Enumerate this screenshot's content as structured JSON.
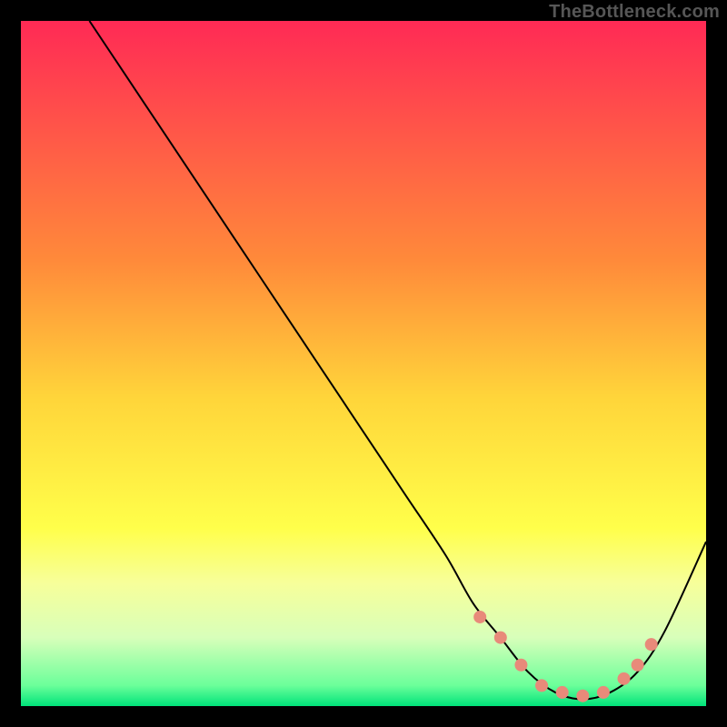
{
  "attribution": "TheBottleneck.com",
  "chart_data": {
    "type": "line",
    "title": "",
    "xlabel": "",
    "ylabel": "",
    "xlim": [
      0,
      100
    ],
    "ylim": [
      0,
      100
    ],
    "background": {
      "type": "vertical-gradient",
      "stops": [
        {
          "offset": 0,
          "color": "#ff2a55"
        },
        {
          "offset": 35,
          "color": "#ff8a3a"
        },
        {
          "offset": 55,
          "color": "#ffd53a"
        },
        {
          "offset": 74,
          "color": "#ffff4a"
        },
        {
          "offset": 82,
          "color": "#f7ff9a"
        },
        {
          "offset": 90,
          "color": "#d8ffba"
        },
        {
          "offset": 97,
          "color": "#6bff9a"
        },
        {
          "offset": 100,
          "color": "#00e37a"
        }
      ]
    },
    "series": [
      {
        "name": "bottleneck-curve",
        "color": "#000000",
        "x": [
          10,
          14,
          20,
          26,
          32,
          38,
          44,
          50,
          56,
          62,
          66,
          70,
          74,
          78,
          82,
          86,
          90,
          94,
          100
        ],
        "y": [
          100,
          94,
          85,
          76,
          67,
          58,
          49,
          40,
          31,
          22,
          15,
          10,
          5,
          2,
          1,
          2,
          5,
          11,
          24
        ]
      }
    ],
    "markers": {
      "name": "highlight-dots",
      "color": "#e88a7a",
      "points": [
        {
          "x": 67,
          "y": 13
        },
        {
          "x": 70,
          "y": 10
        },
        {
          "x": 73,
          "y": 6
        },
        {
          "x": 76,
          "y": 3
        },
        {
          "x": 79,
          "y": 2
        },
        {
          "x": 82,
          "y": 1.5
        },
        {
          "x": 85,
          "y": 2
        },
        {
          "x": 88,
          "y": 4
        },
        {
          "x": 90,
          "y": 6
        },
        {
          "x": 92,
          "y": 9
        }
      ]
    }
  }
}
